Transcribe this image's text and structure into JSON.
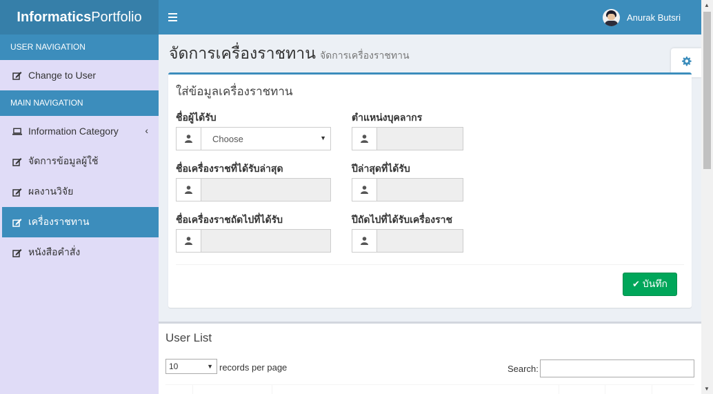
{
  "brand": {
    "bold": "Informatics",
    "light": "Portfolio"
  },
  "navbar": {
    "user_name": "Anurak Butsri"
  },
  "sidebar": {
    "user_header": "USER NAVIGATION",
    "change_user": "Change to User",
    "main_header": "MAIN NAVIGATION",
    "items": [
      {
        "label": "Information Category"
      },
      {
        "label": "จัดการข้อมูลผู้ใช้"
      },
      {
        "label": "ผลงานวิจัย"
      },
      {
        "label": "เครื่องราชทาน"
      },
      {
        "label": "หนังสือคำสั่ง"
      }
    ]
  },
  "page": {
    "title": "จัดการเครื่องราชทาน",
    "subtitle": "จัดการเครื่องราชทาน"
  },
  "form": {
    "title": "ใส่ข้อมูลเครื่องราชทาน",
    "recipient_label": "ชื่อผู้ได้รับ",
    "recipient_value": "Choose",
    "position_label": "ตำแหน่งบุคลากร",
    "latest_label": "ชื่อเครื่องราชที่ได้รับล่าสุด",
    "latest_year_label": "ปีล่าสุดที่ได้รับ",
    "next_label": "ชื่อเครื่องราชถัดไปที่ได้รับ",
    "next_year_label": "ปีถัดไปที่ได้รับเครื่องราช",
    "save_label": "บันทึก"
  },
  "list": {
    "title": "User List",
    "page_length": "10",
    "records_text": "records per page",
    "search_label": "Search:"
  },
  "colors": {
    "primary": "#3c8dbc",
    "success": "#00a65a",
    "sidebar_bg": "#e0dcf7"
  }
}
